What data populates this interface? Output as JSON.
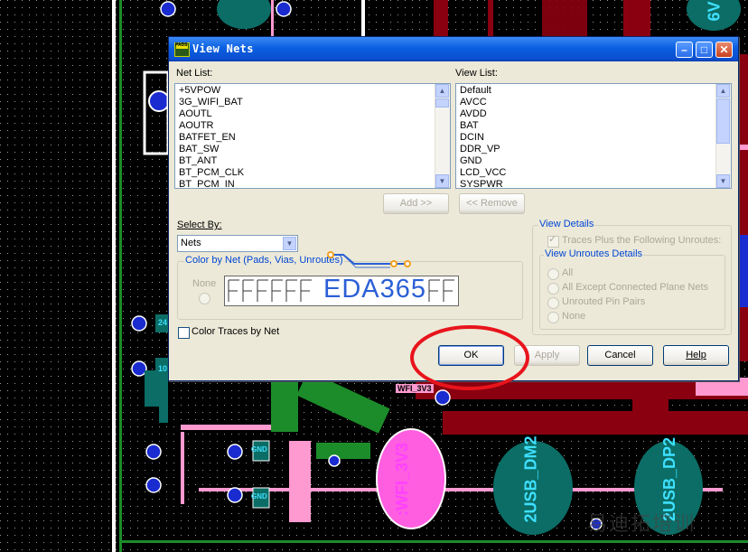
{
  "dialog": {
    "title": "View Nets",
    "icon_text": "PADS",
    "net_list_label": "Net List:",
    "view_list_label": "View List:",
    "net_list": [
      "+5VPOW",
      "3G_WIFI_BAT",
      "AOUTL",
      "AOUTR",
      "BATFET_EN",
      "BAT_SW",
      "BT_ANT",
      "BT_PCM_CLK",
      "BT_PCM_IN"
    ],
    "view_list": [
      "Default",
      "AVCC",
      "AVDD",
      "BAT",
      "DCIN",
      "DDR_VP",
      "GND",
      "LCD_VCC",
      "SYSPWR"
    ],
    "add_button": "Add >>",
    "remove_button": "<< Remove",
    "select_by_label": "Select By:",
    "select_by_value": "Nets",
    "color_by_net_label": "Color by Net (Pads, Vias, Unroutes)",
    "none_label": "None",
    "color_traces_label": "Color Traces by Net",
    "view_details_label": "View Details",
    "traces_plus_label": "Traces Plus the Following Unroutes:",
    "view_unroutes_label": "View Unroutes Details",
    "radio_all": "All",
    "radio_all_except": "All Except Connected Plane Nets",
    "radio_unrouted": "Unrouted Pin Pairs",
    "radio_none": "None",
    "ok_button": "OK",
    "apply_button": "Apply",
    "cancel_button": "Cancel",
    "help_button": "Help"
  },
  "overlay": {
    "logo_text": "EDA365",
    "watermark": "易迪拓培训"
  },
  "pcb": {
    "labels": [
      "6V",
      "WFI_3V3",
      ":WFI_3V3",
      "2USB_DM2",
      "2USB_DP2",
      "GND",
      "GND",
      "10",
      "24"
    ]
  },
  "colors": {
    "title_bar": "#0a5fe0",
    "dialog_bg": "#ece9d8",
    "highlight_circle": "#e8141c",
    "pcb_teal": "#0b6d66",
    "pcb_trace": "#8a0010",
    "pcb_green": "#1c8c2a",
    "pcb_pink": "#ff9ad0"
  }
}
